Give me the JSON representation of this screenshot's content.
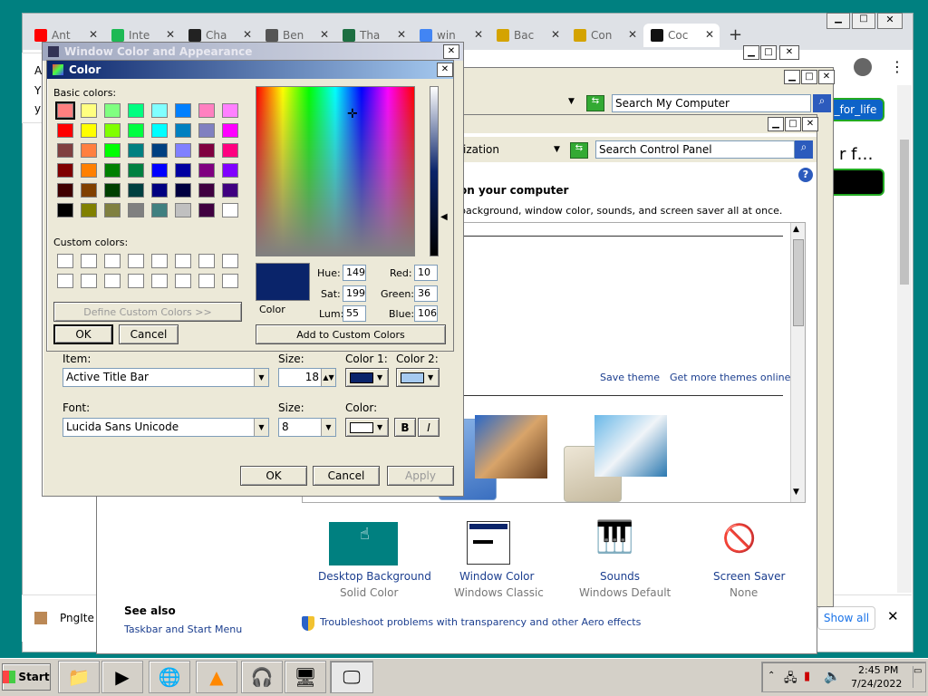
{
  "browser": {
    "tabs": [
      {
        "label": "Ant",
        "icon": "youtube-icon",
        "color": "#ff0000"
      },
      {
        "label": "Inte",
        "icon": "play-icon",
        "color": "#1db954"
      },
      {
        "label": "Cha",
        "icon": "terminal-icon",
        "color": "#222222"
      },
      {
        "label": "Ben",
        "icon": "globe-icon",
        "color": "#555555"
      },
      {
        "label": "Tha",
        "icon": "excel-icon",
        "color": "#1d6f42"
      },
      {
        "label": "win",
        "icon": "google-icon",
        "color": "#4285f4"
      },
      {
        "label": "Bac",
        "icon": "png-icon",
        "color": "#d4a300"
      },
      {
        "label": "Con",
        "icon": "png-icon",
        "color": "#d4a300"
      },
      {
        "label": "Coc",
        "icon": "dark-icon",
        "color": "#111111"
      }
    ],
    "new_tab": "+",
    "page_button1": "_for_life",
    "page_text": "r f…",
    "left_snippet": [
      "A",
      "Y",
      "y"
    ],
    "download_name": "PngIte",
    "show_all": "Show all"
  },
  "my_computer": {
    "search_placeholder": "Search My Computer"
  },
  "control_panel": {
    "address": "ization",
    "search_placeholder": "Search Control Panel",
    "heading": "on your computer",
    "subtext": "background, window color, sounds, and screen saver all at once.",
    "save_theme": "Save theme",
    "more_themes": "Get more themes online",
    "items": [
      {
        "title": "Desktop Background",
        "sub": "Solid Color"
      },
      {
        "title": "Window Color",
        "sub": "Windows Classic"
      },
      {
        "title": "Sounds",
        "sub": "Windows Default"
      },
      {
        "title": "Screen Saver",
        "sub": "None"
      }
    ],
    "see_also": "See also",
    "taskbar_link": "Taskbar and Start Menu",
    "troubleshoot": "Troubleshoot problems with transparency and other Aero effects"
  },
  "wca": {
    "title": "Window Color and Appearance",
    "item_label": "Item:",
    "item_value": "Active Title Bar",
    "size_label": "Size:",
    "size_value": "18",
    "color1_label": "Color 1:",
    "color2_label": "Color 2:",
    "color1": "#0a246a",
    "color2": "#a6caf0",
    "font_label": "Font:",
    "font_value": "Lucida Sans Unicode",
    "font_size_label": "Size:",
    "font_size_value": "8",
    "font_color_label": "Color:",
    "bold": "B",
    "italic": "I",
    "ok": "OK",
    "cancel": "Cancel",
    "apply": "Apply"
  },
  "color_dialog": {
    "title": "Color",
    "basic_label": "Basic colors:",
    "custom_label": "Custom colors:",
    "define_custom": "Define Custom Colors >>",
    "ok": "OK",
    "cancel": "Cancel",
    "add_custom": "Add to Custom Colors",
    "color_label": "Color",
    "hue_label": "Hue:",
    "hue": "149",
    "sat_label": "Sat:",
    "sat": "199",
    "lum_label": "Lum:",
    "lum": "55",
    "red_label": "Red:",
    "red": "10",
    "green_label": "Green:",
    "green": "36",
    "blue_label": "Blue:",
    "blue": "106",
    "current_color": "#0a246a",
    "basic_colors": [
      "#ff8080",
      "#ffff80",
      "#80ff80",
      "#00ff80",
      "#80ffff",
      "#0080ff",
      "#ff80c0",
      "#ff80ff",
      "#ff0000",
      "#ffff00",
      "#80ff00",
      "#00ff40",
      "#00ffff",
      "#0080c0",
      "#8080c0",
      "#ff00ff",
      "#804040",
      "#ff8040",
      "#00ff00",
      "#008080",
      "#004080",
      "#8080ff",
      "#800040",
      "#ff0080",
      "#800000",
      "#ff8000",
      "#008000",
      "#008040",
      "#0000ff",
      "#0000a0",
      "#800080",
      "#8000ff",
      "#400000",
      "#804000",
      "#004000",
      "#004040",
      "#000080",
      "#000040",
      "#400040",
      "#400080",
      "#000000",
      "#808000",
      "#808040",
      "#808080",
      "#408080",
      "#c0c0c0",
      "#400040",
      "#ffffff"
    ]
  },
  "taskbar": {
    "start": "Start",
    "time": "2:45 PM",
    "date": "7/24/2022"
  }
}
